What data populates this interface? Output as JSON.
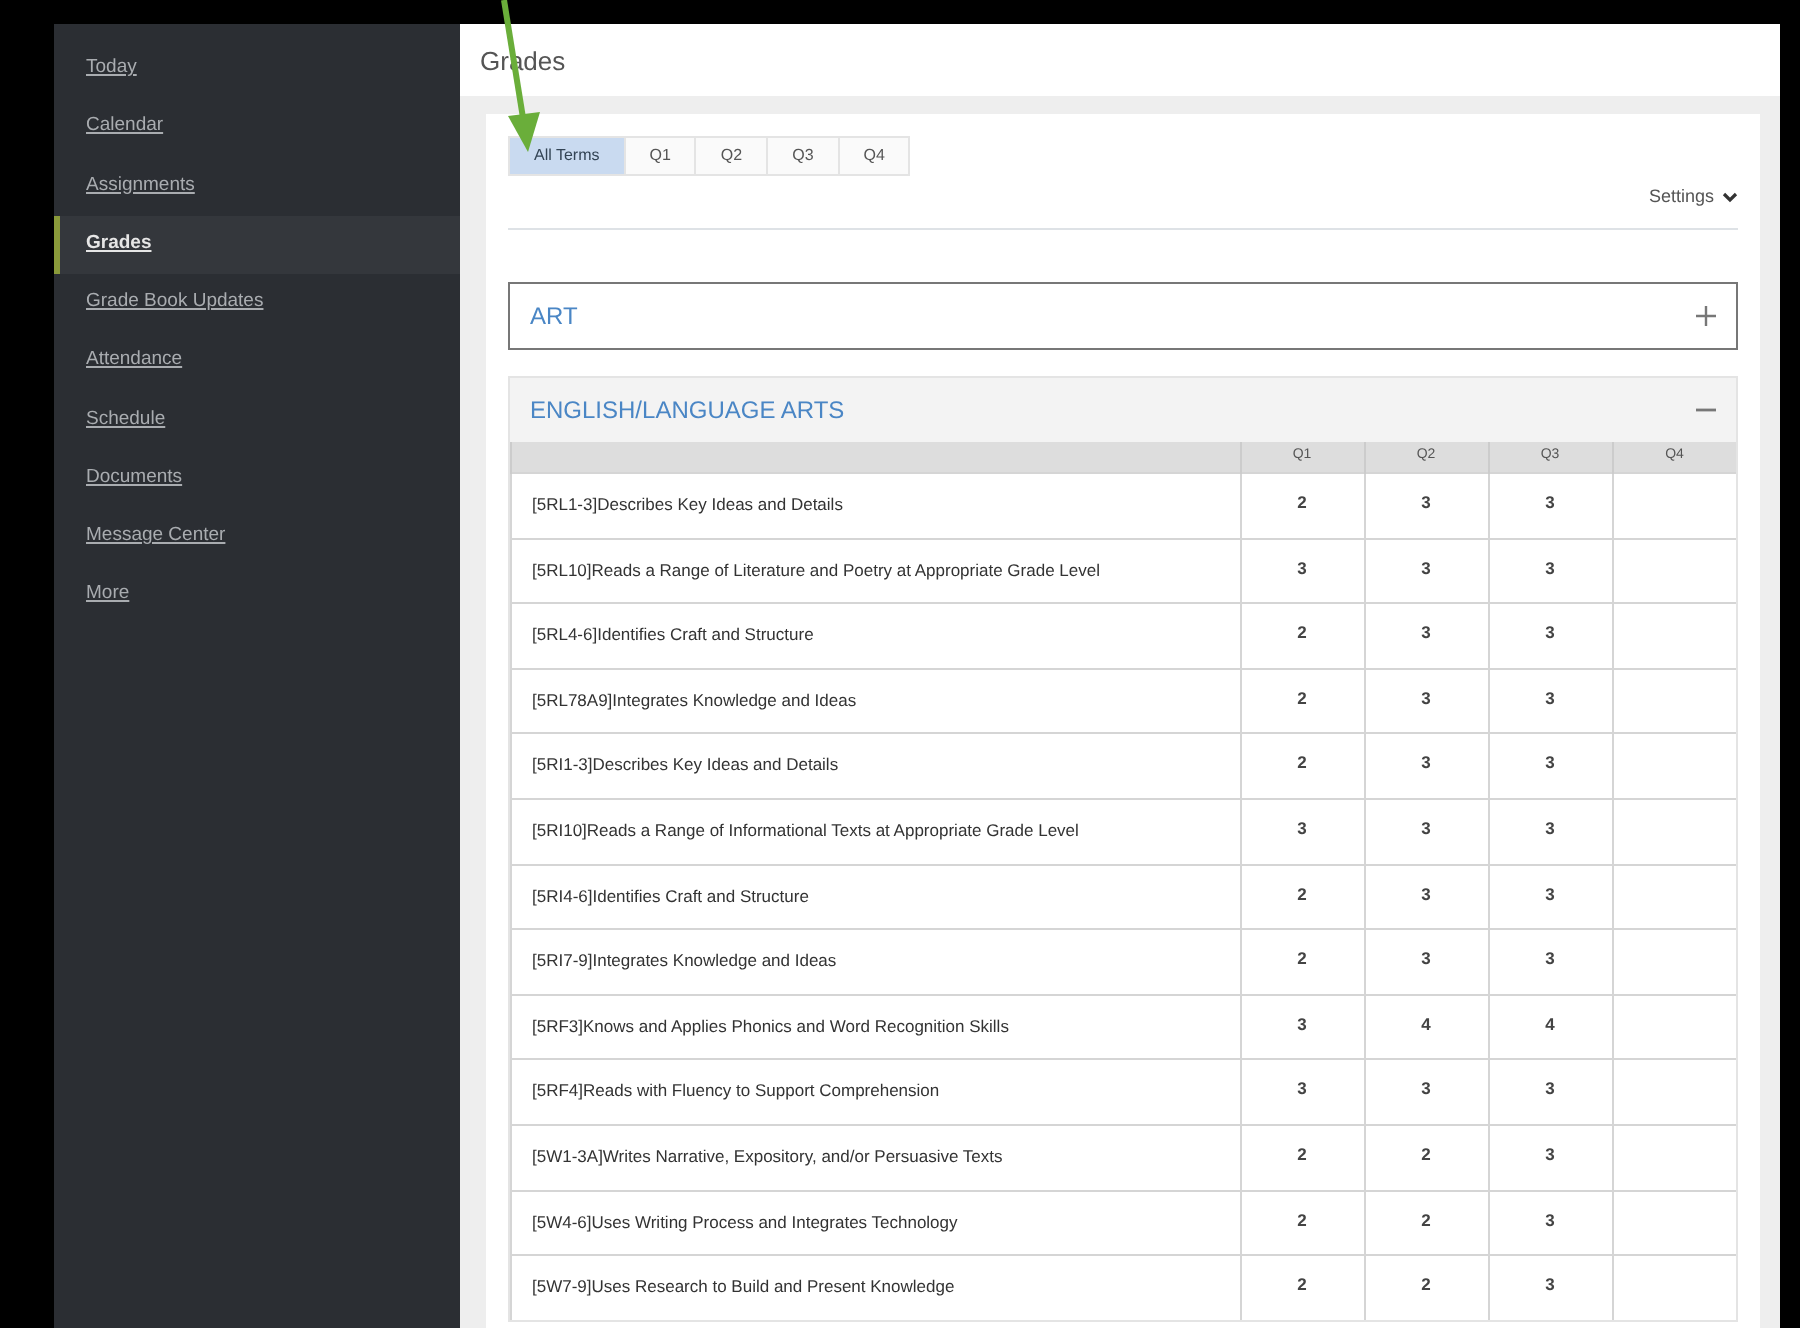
{
  "sidebar": {
    "items": [
      {
        "label": "Today",
        "selected": false
      },
      {
        "label": "Calendar",
        "selected": false
      },
      {
        "label": "Assignments",
        "selected": false
      },
      {
        "label": "Grades",
        "selected": true
      },
      {
        "label": "Grade Book Updates",
        "selected": false
      },
      {
        "label": "Attendance",
        "selected": false
      },
      {
        "label": "Schedule",
        "selected": false
      },
      {
        "label": "Documents",
        "selected": false
      },
      {
        "label": "Message Center",
        "selected": false
      },
      {
        "label": "More",
        "selected": false
      }
    ]
  },
  "page_title": "Grades",
  "term_tabs": [
    {
      "label": "All Terms",
      "selected": true
    },
    {
      "label": "Q1",
      "selected": false
    },
    {
      "label": "Q2",
      "selected": false
    },
    {
      "label": "Q3",
      "selected": false
    },
    {
      "label": "Q4",
      "selected": false
    }
  ],
  "settings": "Settings",
  "subjects": [
    {
      "name": "ART",
      "expanded": false
    },
    {
      "name": "ENGLISH/LANGUAGE ARTS",
      "expanded": true,
      "columns": [
        "Q1",
        "Q2",
        "Q3",
        "Q4"
      ],
      "rows": [
        {
          "standard": "[5RL1-3]Describes Key Ideas and Details",
          "grades": [
            "2",
            "3",
            "3"
          ]
        },
        {
          "standard": "[5RL10]Reads a Range of Literature and Poetry at Appropriate Grade Level",
          "grades": [
            "3",
            "3",
            "3"
          ]
        },
        {
          "standard": "[5RL4-6]Identifies Craft and Structure",
          "grades": [
            "2",
            "3",
            "3"
          ]
        },
        {
          "standard": "[5RL78A9]Integrates Knowledge and Ideas",
          "grades": [
            "2",
            "3",
            "3"
          ]
        },
        {
          "standard": "[5RI1-3]Describes Key Ideas and Details",
          "grades": [
            "2",
            "3",
            "3"
          ]
        },
        {
          "standard": "[5RI10]Reads a Range of Informational Texts at Appropriate Grade Level",
          "grades": [
            "3",
            "3",
            "3"
          ]
        },
        {
          "standard": "[5RI4-6]Identifies Craft and Structure",
          "grades": [
            "2",
            "3",
            "3"
          ]
        },
        {
          "standard": "[5RI7-9]Integrates Knowledge and Ideas",
          "grades": [
            "2",
            "3",
            "3"
          ]
        },
        {
          "standard": "[5RF3]Knows and Applies Phonics and Word Recognition Skills",
          "grades": [
            "3",
            "4",
            "4"
          ]
        },
        {
          "standard": "[5RF4]Reads with Fluency to Support Comprehension",
          "grades": [
            "3",
            "3",
            "3"
          ]
        },
        {
          "standard": "[5W1-3A]Writes Narrative, Expository, and/or Persuasive Texts",
          "grades": [
            "2",
            "2",
            "3"
          ]
        },
        {
          "standard": "[5W4-6]Uses Writing Process and Integrates Technology",
          "grades": [
            "2",
            "2",
            "3"
          ]
        },
        {
          "standard": "[5W7-9]Uses Research to Build and Present Knowledge",
          "grades": [
            "2",
            "2",
            "3"
          ]
        }
      ]
    }
  ]
}
